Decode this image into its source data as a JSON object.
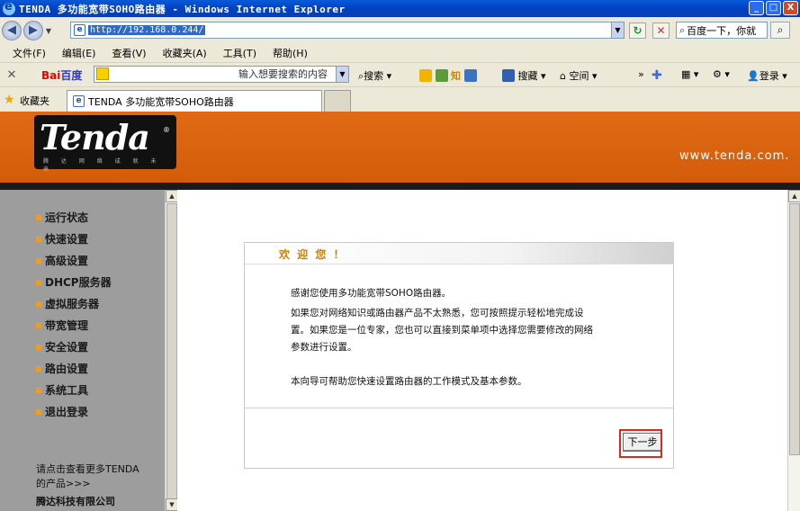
{
  "window": {
    "title": "TENDA 多功能宽带SOHO路由器 - Windows Internet Explorer",
    "minimize": "_",
    "maximize": "□",
    "close": "X"
  },
  "address_bar": {
    "back": "◀",
    "forward": "▶",
    "url": "http://192.168.0.244/",
    "refresh": "↻",
    "stop": "✕",
    "search_text": "百度一下，你就",
    "search_go": "⌕"
  },
  "menu": [
    "文件(F)",
    "编辑(E)",
    "查看(V)",
    "收藏夹(A)",
    "工具(T)",
    "帮助(H)"
  ],
  "baidu_toolbar": {
    "close": "✕",
    "logo_a": "Bai",
    "logo_b": "百度",
    "input_placeholder": "输入想要搜索的内容",
    "search_label": "搜索",
    "zhi": "知",
    "news": "搜藏",
    "space": "空间",
    "login": "登录",
    "more": "»"
  },
  "favorites": {
    "label": "收藏夹",
    "tab_title": "TENDA 多功能宽带SOHO路由器"
  },
  "brand": {
    "logo": "Tenda",
    "reg": "®",
    "sub": "腾 达 网 络 成 就 未 来",
    "url": "www.tenda.com."
  },
  "sidebar": {
    "items": [
      "运行状态",
      "快速设置",
      "高级设置",
      "DHCP服务器",
      "虚拟服务器",
      "带宽管理",
      "安全设置",
      "路由设置",
      "系统工具",
      "退出登录"
    ],
    "footer_line1": "请点击查看更多TENDA",
    "footer_line2": "的产品>>>",
    "company": "腾达科技有限公司"
  },
  "wizard": {
    "title": "欢 迎 您 ！",
    "p1": "感谢您使用多功能宽带SOHO路由器。",
    "p2a": "如果您对网络知识或路由器产品不太熟悉，您可按照提示轻松地完成设",
    "p2b": "置。如果您是一位专家，您也可以直接到菜单项中选择您需要修改的网络",
    "p2c": "参数进行设置。",
    "p3": "本向导可帮助您快速设置路由器的工作模式及基本参数。",
    "next": "下一步"
  }
}
